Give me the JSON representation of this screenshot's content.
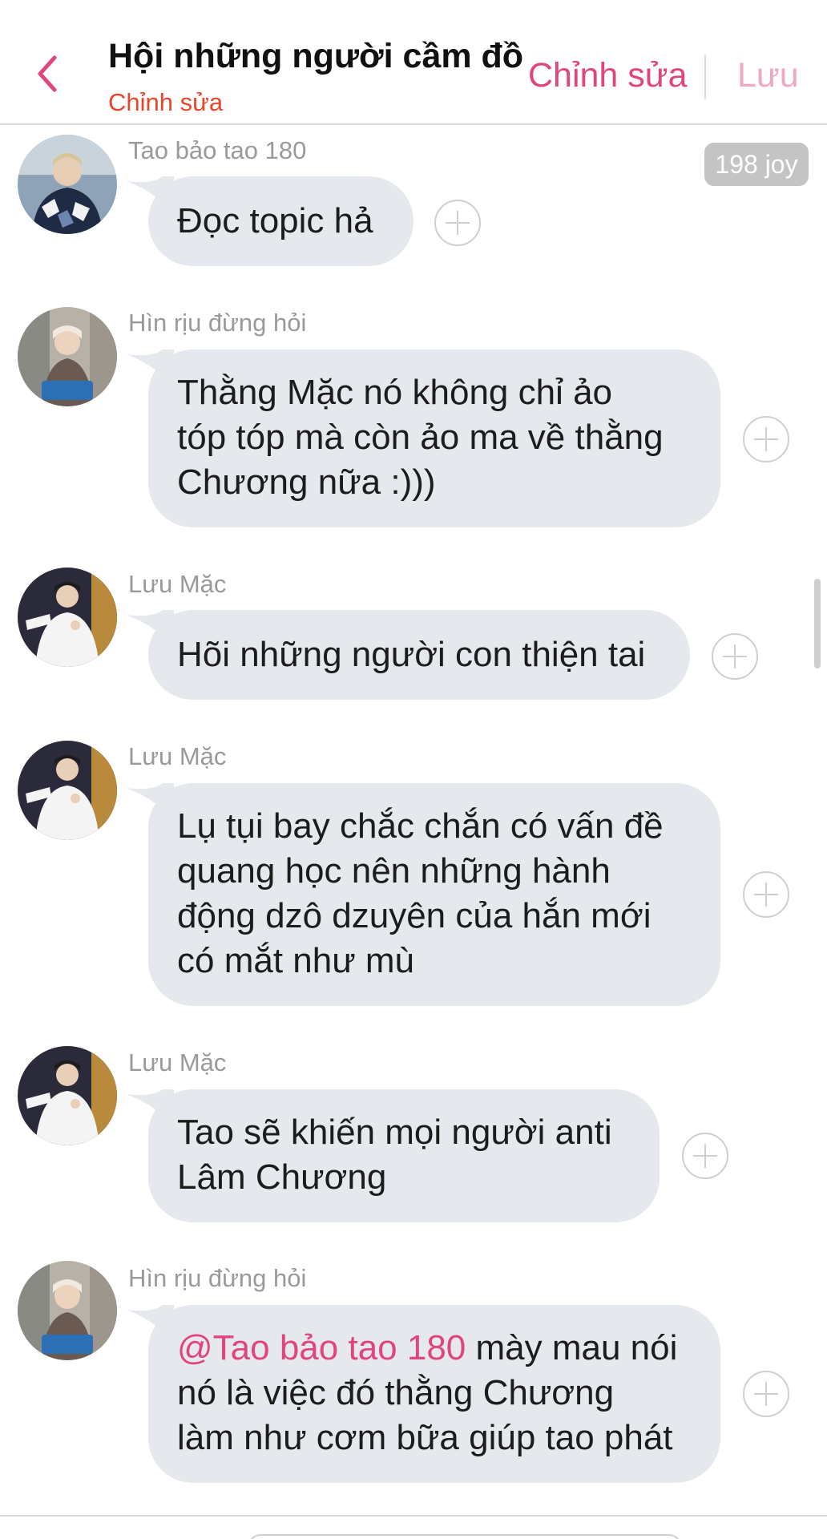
{
  "header": {
    "title": "Hội những người cầm đồ",
    "subtitle": "Chỉnh sửa",
    "edit_label": "Chỉnh sửa",
    "save_label": "Lưu"
  },
  "joy_badge": "198 joy",
  "messages": [
    {
      "sender": "Tao bảo tao 180",
      "lines": [
        "Đọc topic hả"
      ]
    },
    {
      "sender": "Hìn rịu đừng hỏi",
      "lines": [
        "Thằng Mặc nó không chỉ ảo",
        "tóp tóp mà còn ảo ma về thằng",
        "Chương nữa :)))"
      ]
    },
    {
      "sender": "Lưu Mặc",
      "lines": [
        "Hõi những người con thiện tai"
      ]
    },
    {
      "sender": "Lưu Mặc",
      "lines": [
        "Lụ tụi bay chắc chắn có vấn đề",
        "quang học nên những hành",
        "động dzô dzuyên của hắn mới",
        "có mắt như mù"
      ]
    },
    {
      "sender": "Lưu Mặc",
      "lines": [
        "Tao sẽ khiến mọi người anti",
        "Lâm Chương"
      ]
    },
    {
      "sender": "Hìn rịu đừng hỏi",
      "mention": "@Tao bảo tao 180",
      "lines": [
        " mày mau nói",
        "nó là việc đó thằng Chương",
        "làm như cơm bữa giúp tao phát"
      ]
    }
  ],
  "colors": {
    "accent": "#e0467c",
    "subtitle": "#e8452c",
    "bubble": "#e5e8ec",
    "sender": "#9a9a9a"
  }
}
